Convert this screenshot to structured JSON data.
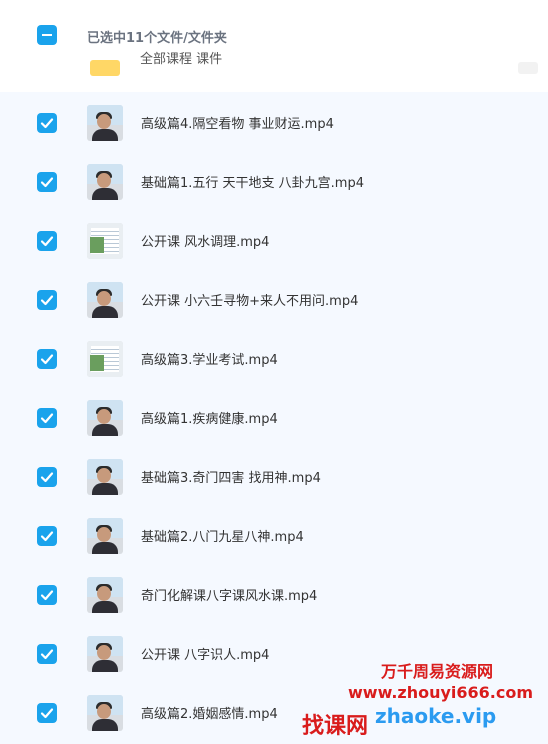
{
  "header": {
    "selected_text": "已选中11个文件/文件夹",
    "checkbox_state": "indeterminate"
  },
  "partial_row": {
    "name": "全部课程 课件",
    "icon": "folder-icon"
  },
  "files": [
    {
      "name": "高级篇4.隔空看物 事业财运.mp4",
      "checked": true,
      "thumb": "person"
    },
    {
      "name": "基础篇1.五行 天干地支 八卦九宫.mp4",
      "checked": true,
      "thumb": "person"
    },
    {
      "name": "公开课 风水调理.mp4",
      "checked": true,
      "thumb": "chart"
    },
    {
      "name": "公开课 小六壬寻物+来人不用问.mp4",
      "checked": true,
      "thumb": "person"
    },
    {
      "name": "高级篇3.学业考试.mp4",
      "checked": true,
      "thumb": "chart"
    },
    {
      "name": "高级篇1.疾病健康.mp4",
      "checked": true,
      "thumb": "person"
    },
    {
      "name": "基础篇3.奇门四害 找用神.mp4",
      "checked": true,
      "thumb": "person"
    },
    {
      "name": "基础篇2.八门九星八神.mp4",
      "checked": true,
      "thumb": "person"
    },
    {
      "name": "奇门化解课八字课风水课.mp4",
      "checked": true,
      "thumb": "person"
    },
    {
      "name": "公开课 八字识人.mp4",
      "checked": true,
      "thumb": "person"
    },
    {
      "name": "高级篇2.婚姻感情.mp4",
      "checked": true,
      "thumb": "person"
    }
  ],
  "watermark": {
    "line1": "万千周易资源网",
    "line2": "www.zhouyi666.com",
    "line3": "找课网",
    "line4": "zhaoke.vip"
  },
  "colors": {
    "checkbox": "#1aa3ec",
    "list_bg": "#f5f9ff",
    "watermark_red": "#d91c1c",
    "watermark_blue": "#2b9bf0"
  }
}
